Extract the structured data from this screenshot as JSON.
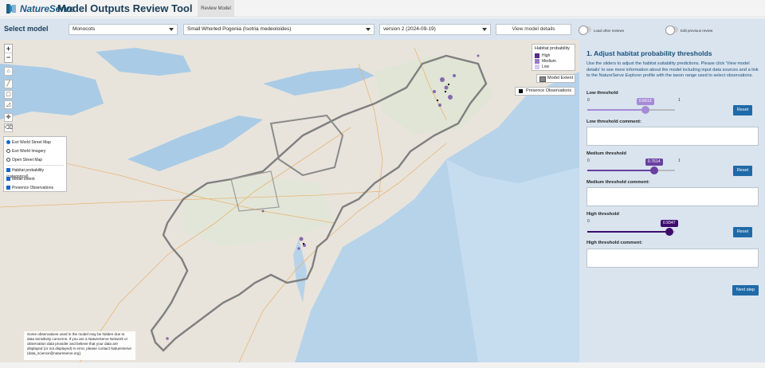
{
  "header": {
    "brand": "NatureServe",
    "app_title": "Model Outputs Review Tool",
    "tab_label": "Review Model"
  },
  "toolbar": {
    "select_label": "Select model",
    "group_select": "Monocots",
    "species_select": "Small Whorled Pogonia (Isotria medeoloides)",
    "version_select": "version 2 (2024-09-19)",
    "view_details_label": "View model details",
    "load_other_reviews_label": "Load other reviews",
    "edit_previous_review_label": "Edit previous review"
  },
  "map": {
    "zoom_in": "+",
    "zoom_out": "−",
    "basemaps": [
      {
        "label": "Esri World Street Map",
        "selected": true
      },
      {
        "label": "Esri World Imagery",
        "selected": false
      },
      {
        "label": "Open Street Map",
        "selected": false
      }
    ],
    "overlays": [
      {
        "label": "Habitat probability (categorical)",
        "checked": true
      },
      {
        "label": "Model extent",
        "checked": true
      },
      {
        "label": "Presence Observations",
        "checked": true
      }
    ],
    "legend": {
      "title": "Habitat probability",
      "items": [
        {
          "label": "High",
          "color": "#5b2a86"
        },
        {
          "label": "Medium",
          "color": "#9b7ac7"
        },
        {
          "label": "Low",
          "color": "#d8c9ee"
        }
      ]
    },
    "extent_label": "Model Extent",
    "observations_label": "Presence Observations",
    "disclaimer": "Some observations used in the model may be hidden due to data sensitivity concerns. If you are a NatureServe Network or observation data provider and believe that your data are displayed (or not displayed) in error, please contact NatureServe (data_science@natureserve.org)."
  },
  "panel": {
    "heading": "1. Adjust habitat probability thresholds",
    "description": "Use the sliders to adjust the habitat suitability predictions. Please click 'View model details' to see more information about the model including input data sources and a link to the NatureServe Explorer profile with the taxon range used to select observations.",
    "thresholds": [
      {
        "label": "Low threshold",
        "min": "0",
        "max": "1",
        "value": 0.6613,
        "value_text": "0.6613",
        "color": "#a58bd6",
        "reset_label": "Reset",
        "comment_label": "Low threshold comment:"
      },
      {
        "label": "Medium threshold",
        "min": "0",
        "max": "1",
        "value": 0.7614,
        "value_text": "0.7614",
        "color": "#6a3fa0",
        "reset_label": "Reset",
        "comment_label": "Medium threshold comment:"
      },
      {
        "label": "High threshold",
        "min": "0",
        "max": "1",
        "value": 0.9347,
        "value_text": "0.9347",
        "color": "#3d0d6e",
        "reset_label": "Reset",
        "comment_label": "High threshold comment:"
      }
    ],
    "next_label": "Next step"
  }
}
